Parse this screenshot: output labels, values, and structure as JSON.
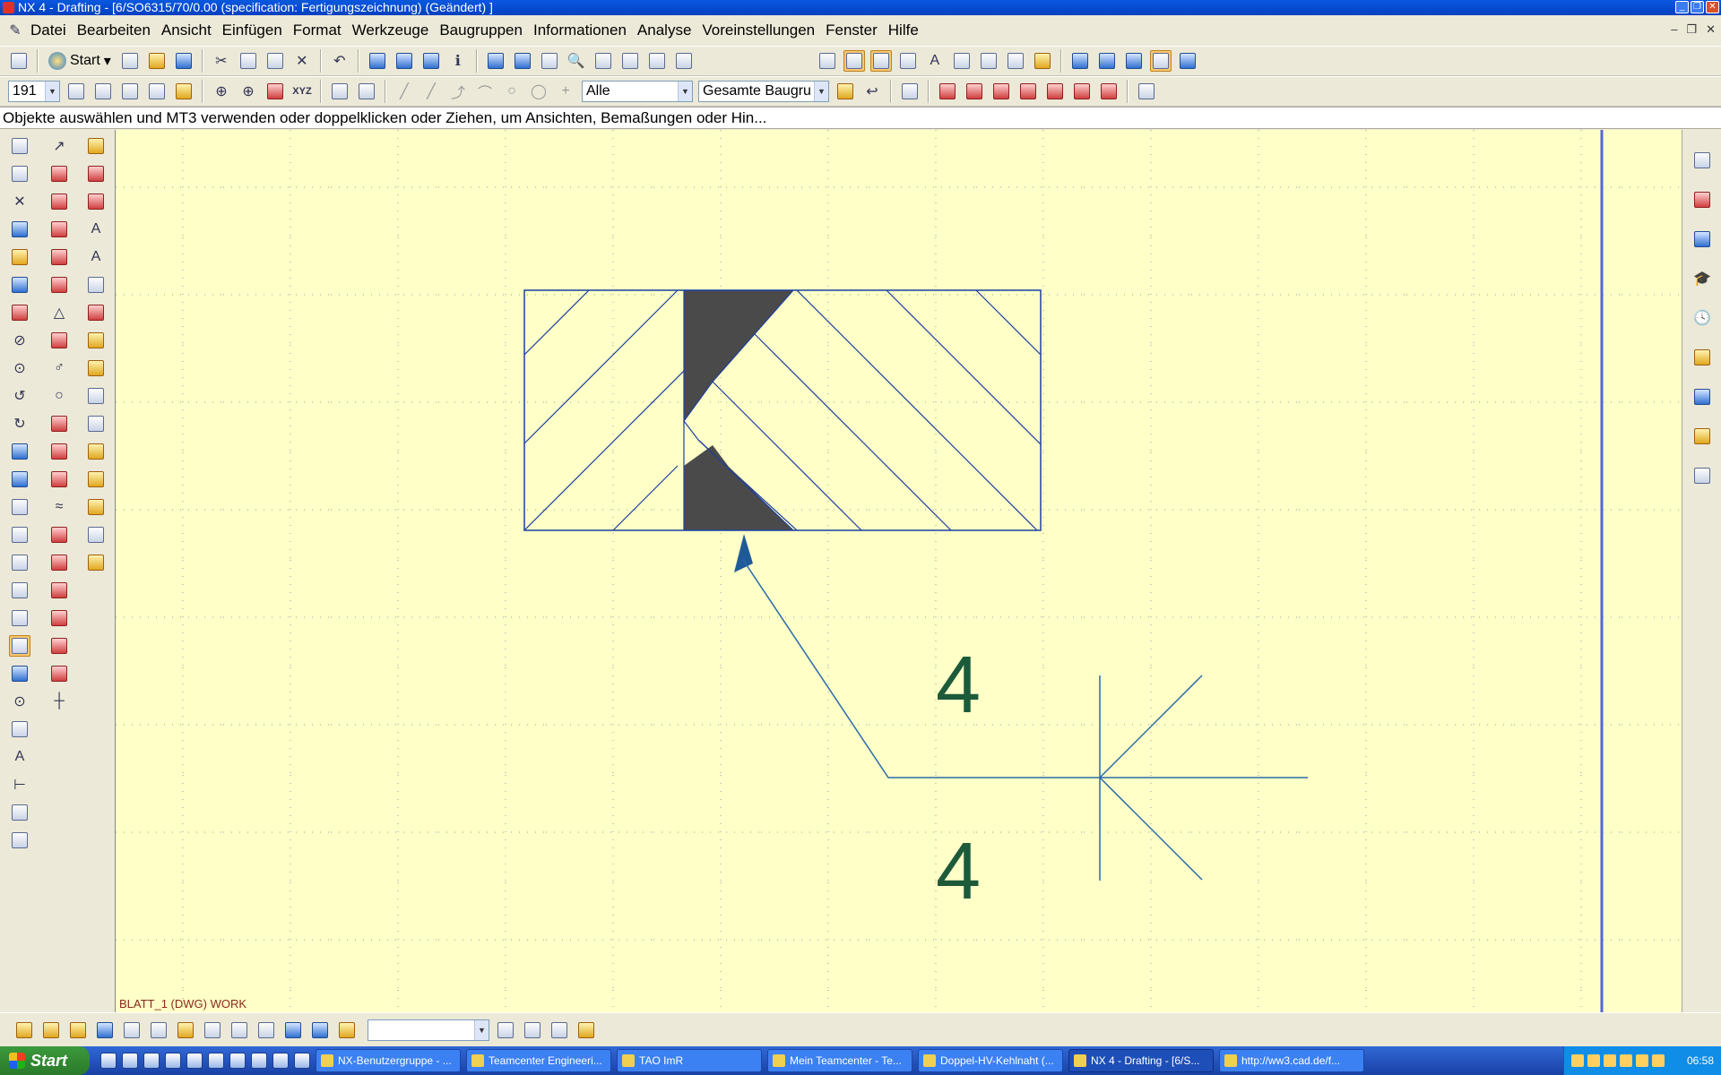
{
  "window": {
    "title": "NX 4 - Drafting - [6/SO6315/70/0.00 (specification: Fertigungszeichnung) (Geändert) ]"
  },
  "menu": [
    "Datei",
    "Bearbeiten",
    "Ansicht",
    "Einfügen",
    "Format",
    "Werkzeuge",
    "Baugruppen",
    "Informationen",
    "Analyse",
    "Voreinstellungen",
    "Fenster",
    "Hilfe"
  ],
  "toolbar1": {
    "start_label": "Start"
  },
  "toolbar2": {
    "layer_value": "191",
    "filter_value": "Alle",
    "assembly_value": "Gesamte Baugru"
  },
  "cue_line": "Objekte auswählen und MT3 verwenden oder doppelklicken oder Ziehen, um Ansichten, Bemaßungen oder Hin...",
  "canvas": {
    "sheet_status": "BLATT_1 (DWG) WORK",
    "weld_symbol": {
      "top_size": "4",
      "bottom_size": "4"
    },
    "colors": {
      "background": "#ffffc8",
      "geometry": "#1c3fa0",
      "leader": "#2a6aa8",
      "annotation": "#1c5a3a"
    }
  },
  "bottombar": {
    "combo_value": ""
  },
  "taskbar": {
    "start_label": "Start",
    "tasks": [
      {
        "label": "NX-Benutzergruppe - ..."
      },
      {
        "label": "Teamcenter Engineeri..."
      },
      {
        "label": "TAO ImR"
      },
      {
        "label": "Mein Teamcenter - Te..."
      },
      {
        "label": "Doppel-HV-Kehlnaht (..."
      },
      {
        "label": "NX 4 - Drafting - [6/S..."
      },
      {
        "label": "http://ww3.cad.de/f..."
      }
    ],
    "clock": "06:58"
  }
}
